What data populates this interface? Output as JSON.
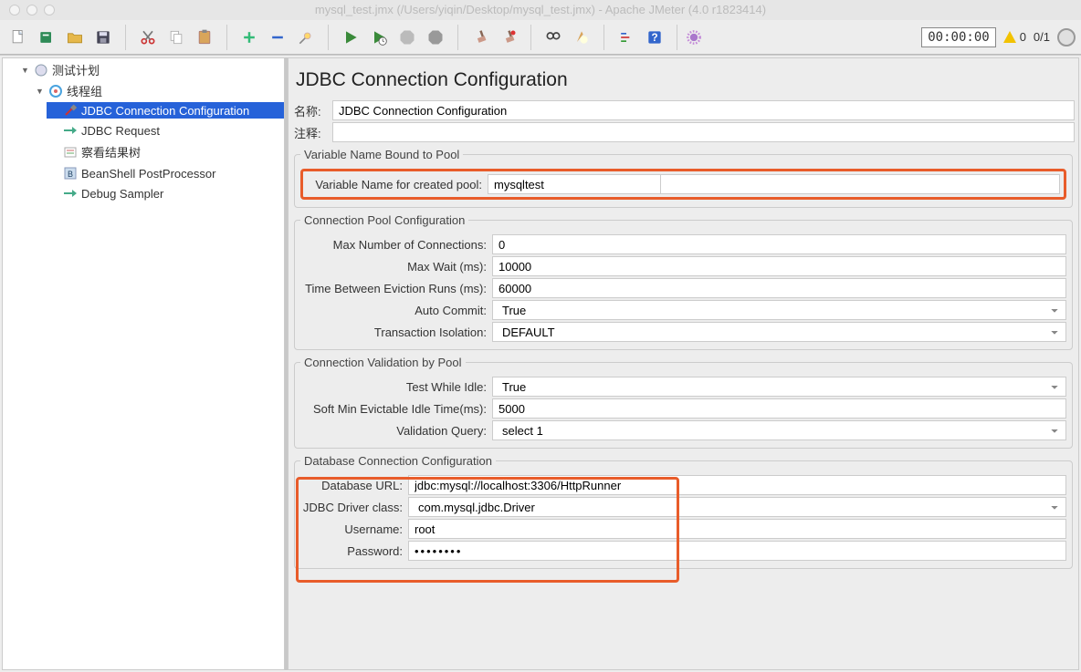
{
  "window": {
    "title": "mysql_test.jmx (/Users/yiqin/Desktop/mysql_test.jmx) - Apache JMeter (4.0 r1823414)"
  },
  "status": {
    "time": "00:00:00",
    "warn_count": "0",
    "thread_count": "0/1"
  },
  "tree": {
    "root": "测试计划",
    "thread_group": "线程组",
    "items": [
      "JDBC Connection Configuration",
      "JDBC Request",
      "察看结果树",
      "BeanShell PostProcessor",
      "Debug Sampler"
    ]
  },
  "panel": {
    "title": "JDBC Connection Configuration",
    "name_label": "名称:",
    "name_value": "JDBC Connection Configuration",
    "comment_label": "注释:",
    "comment_value": ""
  },
  "varbound": {
    "legend": "Variable Name Bound to Pool",
    "label": "Variable Name for created pool:",
    "value": "mysqltest"
  },
  "pool": {
    "legend": "Connection Pool Configuration",
    "max_conn_label": "Max Number of Connections:",
    "max_conn": "0",
    "max_wait_label": "Max Wait (ms):",
    "max_wait": "10000",
    "eviction_label": "Time Between Eviction Runs (ms):",
    "eviction": "60000",
    "auto_commit_label": "Auto Commit:",
    "auto_commit": "True",
    "isolation_label": "Transaction Isolation:",
    "isolation": "DEFAULT"
  },
  "validation": {
    "legend": "Connection Validation by Pool",
    "test_idle_label": "Test While Idle:",
    "test_idle": "True",
    "soft_min_label": "Soft Min Evictable Idle Time(ms):",
    "soft_min": "5000",
    "vquery_label": "Validation Query:",
    "vquery": "select 1"
  },
  "db": {
    "legend": "Database Connection Configuration",
    "url_label": "Database URL:",
    "url": "jdbc:mysql://localhost:3306/HttpRunner",
    "driver_label": "JDBC Driver class:",
    "driver": "com.mysql.jdbc.Driver",
    "user_label": "Username:",
    "user": "root",
    "pw_label": "Password:",
    "pw": "••••••••"
  },
  "icons": {
    "file_new": "📄",
    "templates": "📘",
    "open": "📂",
    "save": "💾",
    "cut": "✂️",
    "copy": "📄",
    "paste": "📋",
    "plus": "➕",
    "minus": "➖",
    "wand": "🪄",
    "play_green": "▶",
    "play_time": "▶",
    "stop": "■",
    "stop_all": "■",
    "brush1": "🧹",
    "brush2": "🧹",
    "binoc": "🔭",
    "broom": "🧽",
    "list": "☰",
    "help": "?",
    "gear": "⚙"
  }
}
